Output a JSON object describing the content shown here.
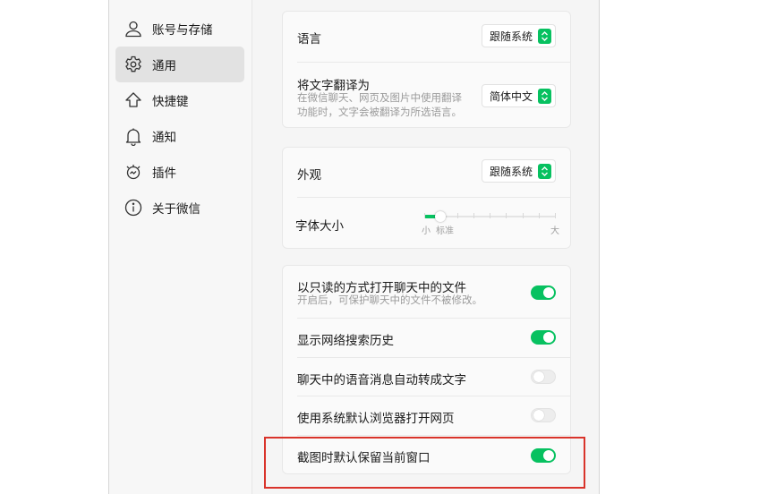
{
  "sidebar": {
    "items": [
      {
        "label": "账号与存储",
        "icon": "person-icon",
        "active": false
      },
      {
        "label": "通用",
        "icon": "gear-icon",
        "active": true
      },
      {
        "label": "快捷键",
        "icon": "shortcut-arrow-icon",
        "active": false
      },
      {
        "label": "通知",
        "icon": "bell-icon",
        "active": false
      },
      {
        "label": "插件",
        "icon": "plugin-icon",
        "active": false
      },
      {
        "label": "关于微信",
        "icon": "info-icon",
        "active": false
      }
    ]
  },
  "language": {
    "title": "语言",
    "value": "跟随系统"
  },
  "translate": {
    "title": "将文字翻译为",
    "desc_line1": "在微信聊天、网页及图片中使用翻译",
    "desc_line2": "功能时，文字会被翻译为所选语言。",
    "value": "简体中文"
  },
  "appearance": {
    "title": "外观",
    "value": "跟随系统"
  },
  "font_size": {
    "title": "字体大小",
    "label_small": "小",
    "label_standard": "标准",
    "label_large": "大",
    "steps": 9,
    "current_step": 1
  },
  "toggles": {
    "readonly": {
      "title": "以只读的方式打开聊天中的文件",
      "desc": "开启后，可保护聊天中的文件不被修改。",
      "on": true
    },
    "search_history": {
      "title": "显示网络搜索历史",
      "on": true
    },
    "voice_to_text": {
      "title": "聊天中的语音消息自动转成文字",
      "on": false
    },
    "system_browser": {
      "title": "使用系统默认浏览器打开网页",
      "on": false
    },
    "screenshot_keep": {
      "title": "截图时默认保留当前窗口",
      "on": true
    }
  },
  "colors": {
    "accent": "#07c160",
    "highlight": "#d9342b"
  }
}
